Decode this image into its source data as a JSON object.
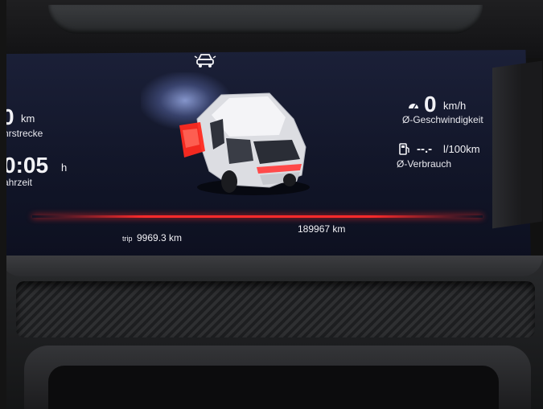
{
  "cluster": {
    "left": {
      "distance_value": "0",
      "distance_unit": "km",
      "distance_label": "hrstrecke",
      "time_value": "0:05",
      "time_unit": "h",
      "time_label": "ahrzeit"
    },
    "right": {
      "speed_value": "0",
      "speed_unit": "km/h",
      "speed_label": "Ø-Geschwindigkeit",
      "consumption_value": "--.-",
      "consumption_unit": "l/100km",
      "consumption_label": "Ø-Verbrauch"
    },
    "bottom": {
      "trip_prefix": "trip",
      "trip_value": "9969.3 km",
      "odometer": "189967 km"
    },
    "icons": {
      "top": "car-assist-icon",
      "speed": "speedometer-icon",
      "fuel": "fuel-pump-icon"
    },
    "colors": {
      "accent_red": "#ff2b2b",
      "text": "#f2f2f6",
      "screen_bg": "#141a30"
    }
  }
}
